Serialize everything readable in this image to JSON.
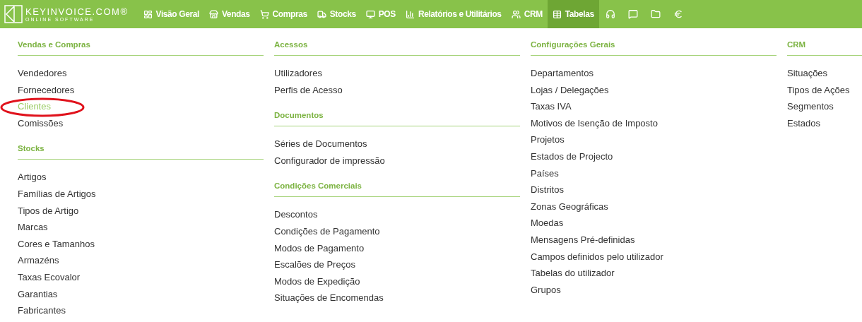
{
  "logo": {
    "name": "KEYINVOICE.COM®",
    "tagline": "ONLINE SOFTWARE"
  },
  "nav": [
    {
      "label": "Visão Geral",
      "selected": false
    },
    {
      "label": "Vendas",
      "selected": false
    },
    {
      "label": "Compras",
      "selected": false
    },
    {
      "label": "Stocks",
      "selected": false
    },
    {
      "label": "POS",
      "selected": false
    },
    {
      "label": "Relatórios e Utilitários",
      "selected": false
    },
    {
      "label": "CRM",
      "selected": false
    },
    {
      "label": "Tabelas",
      "selected": true
    }
  ],
  "columns": [
    {
      "sections": [
        {
          "title": "Vendas e Compras",
          "items": [
            {
              "label": "Vendedores",
              "selected": false
            },
            {
              "label": "Fornecedores",
              "selected": false
            },
            {
              "label": "Clientes",
              "selected": true
            },
            {
              "label": "Comissões",
              "selected": false
            }
          ]
        },
        {
          "title": "Stocks",
          "items": [
            {
              "label": "Artigos",
              "selected": false
            },
            {
              "label": "Famílias de Artigos",
              "selected": false
            },
            {
              "label": "Tipos de Artigo",
              "selected": false
            },
            {
              "label": "Marcas",
              "selected": false
            },
            {
              "label": "Cores e Tamanhos",
              "selected": false
            },
            {
              "label": "Armazéns",
              "selected": false
            },
            {
              "label": "Taxas Ecovalor",
              "selected": false
            },
            {
              "label": "Garantias",
              "selected": false
            },
            {
              "label": "Fabricantes",
              "selected": false
            }
          ]
        }
      ]
    },
    {
      "sections": [
        {
          "title": "Acessos",
          "items": [
            {
              "label": "Utilizadores",
              "selected": false
            },
            {
              "label": "Perfis de Acesso",
              "selected": false
            }
          ]
        },
        {
          "title": "Documentos",
          "items": [
            {
              "label": "Séries de Documentos",
              "selected": false
            },
            {
              "label": "Configurador de impressão",
              "selected": false
            }
          ]
        },
        {
          "title": "Condições Comerciais",
          "items": [
            {
              "label": "Descontos",
              "selected": false
            },
            {
              "label": "Condições de Pagamento",
              "selected": false
            },
            {
              "label": "Modos de Pagamento",
              "selected": false
            },
            {
              "label": "Escalões de Preços",
              "selected": false
            },
            {
              "label": "Modos de Expedição",
              "selected": false
            },
            {
              "label": "Situações de Encomendas",
              "selected": false
            }
          ]
        }
      ]
    },
    {
      "sections": [
        {
          "title": "Configurações Gerais",
          "items": [
            {
              "label": "Departamentos",
              "selected": false
            },
            {
              "label": "Lojas / Delegações",
              "selected": false
            },
            {
              "label": "Taxas IVA",
              "selected": false
            },
            {
              "label": "Motivos de Isenção de Imposto",
              "selected": false
            },
            {
              "label": "Projetos",
              "selected": false
            },
            {
              "label": "Estados de Projecto",
              "selected": false
            },
            {
              "label": "Países",
              "selected": false
            },
            {
              "label": "Distritos",
              "selected": false
            },
            {
              "label": "Zonas Geográficas",
              "selected": false
            },
            {
              "label": "Moedas",
              "selected": false
            },
            {
              "label": "Mensagens Pré-definidas",
              "selected": false
            },
            {
              "label": "Campos definidos pelo utilizador",
              "selected": false
            },
            {
              "label": "Tabelas do utilizador",
              "selected": false
            },
            {
              "label": "Grupos",
              "selected": false
            }
          ]
        }
      ]
    },
    {
      "sections": [
        {
          "title": "CRM",
          "items": [
            {
              "label": "Situações",
              "selected": false
            },
            {
              "label": "Tipos de Ações",
              "selected": false
            },
            {
              "label": "Segmentos",
              "selected": false
            },
            {
              "label": "Estados",
              "selected": false
            }
          ]
        }
      ]
    }
  ],
  "annotation": {
    "kind": "ellipse"
  }
}
